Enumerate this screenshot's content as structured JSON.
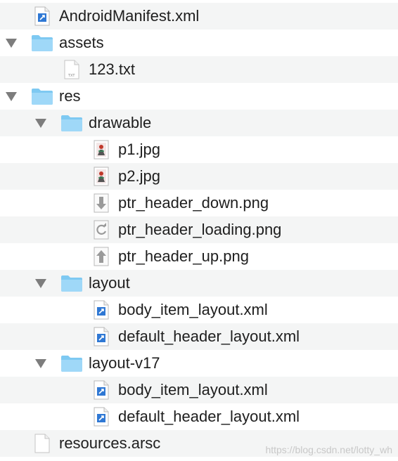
{
  "tree": [
    {
      "name": "AndroidManifest.xml",
      "kind": "file",
      "icon": "xml-file-icon",
      "depth": 1
    },
    {
      "name": "assets",
      "kind": "folder",
      "icon": "folder-icon",
      "depth": 1,
      "expanded": true
    },
    {
      "name": "123.txt",
      "kind": "file",
      "icon": "text-file-icon",
      "depth": 2
    },
    {
      "name": "res",
      "kind": "folder",
      "icon": "folder-icon",
      "depth": 1,
      "expanded": true
    },
    {
      "name": "drawable",
      "kind": "folder",
      "icon": "folder-icon",
      "depth": 2,
      "expanded": true
    },
    {
      "name": "p1.jpg",
      "kind": "file",
      "icon": "image-file-icon",
      "depth": 3
    },
    {
      "name": "p2.jpg",
      "kind": "file",
      "icon": "image-file-icon",
      "depth": 3
    },
    {
      "name": "ptr_header_down.png",
      "kind": "file",
      "icon": "arrow-down-image-icon",
      "depth": 3
    },
    {
      "name": "ptr_header_loading.png",
      "kind": "file",
      "icon": "refresh-image-icon",
      "depth": 3
    },
    {
      "name": "ptr_header_up.png",
      "kind": "file",
      "icon": "arrow-up-image-icon",
      "depth": 3
    },
    {
      "name": "layout",
      "kind": "folder",
      "icon": "folder-icon",
      "depth": 2,
      "expanded": true
    },
    {
      "name": "body_item_layout.xml",
      "kind": "file",
      "icon": "xml-file-icon",
      "depth": 3
    },
    {
      "name": "default_header_layout.xml",
      "kind": "file",
      "icon": "xml-file-icon",
      "depth": 3
    },
    {
      "name": "layout-v17",
      "kind": "folder",
      "icon": "folder-icon",
      "depth": 2,
      "expanded": true
    },
    {
      "name": "body_item_layout.xml",
      "kind": "file",
      "icon": "xml-file-icon",
      "depth": 3
    },
    {
      "name": "default_header_layout.xml",
      "kind": "file",
      "icon": "xml-file-icon",
      "depth": 3
    },
    {
      "name": "resources.arsc",
      "kind": "file",
      "icon": "blank-file-icon",
      "depth": 1
    }
  ],
  "watermark": "https://blog.csdn.net/lotty_wh",
  "colors": {
    "folder": "#6ec6f5",
    "row_alt": "#f4f5f5",
    "disclosure": "#7d7d7d"
  }
}
